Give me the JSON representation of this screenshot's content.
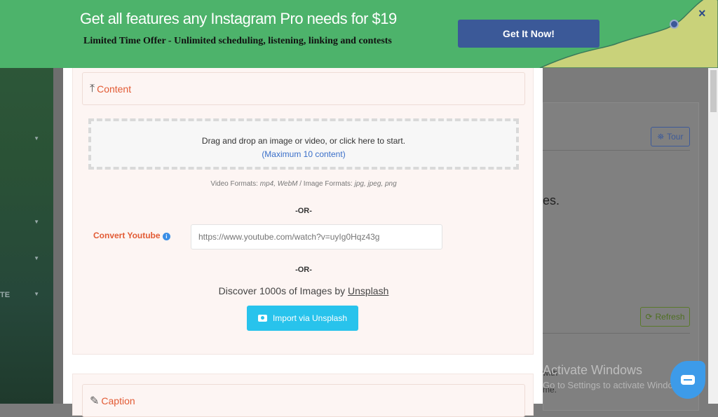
{
  "banner": {
    "title": "Get all features any Instagram Pro needs for $19",
    "subtitle": "Limited Time Offer - Unlimited scheduling, listening, linking and contests",
    "cta": "Get It Now!",
    "close": "×",
    "bg_color": "#4db36b",
    "cta_color": "#3b5998"
  },
  "sidebar": {
    "items": [
      {
        "label": ""
      },
      {
        "label": ""
      },
      {
        "label": ""
      },
      {
        "label": "TE"
      }
    ]
  },
  "content": {
    "header": "Content",
    "drop_text": "Drag and drop an image or video, or click here to start.",
    "drop_max": "(Maximum 10 content)",
    "formats_video_label": "Video Formats: ",
    "formats_video": "mp4, WebM",
    "formats_sep": " / Image Formats: ",
    "formats_image": "jpg, jpeg, png",
    "or1": "-OR-",
    "youtube_label": "Convert Youtube",
    "youtube_placeholder": "https://www.youtube.com/watch?v=uyIg0Hqz43g",
    "or2": "-OR-",
    "discover_text": "Discover 1000s of Images by ",
    "discover_link": "Unsplash",
    "import_button": "Import via Unsplash",
    "accent_color": "#e25b35"
  },
  "caption": {
    "header": "Caption"
  },
  "background": {
    "tour": "Tour",
    "partial_text": "es.",
    "refresh": "Refresh",
    "under1": "with",
    "under2": "me."
  },
  "windows": {
    "line1": "Activate Windows",
    "line2": "Go to Settings to activate Windows."
  }
}
